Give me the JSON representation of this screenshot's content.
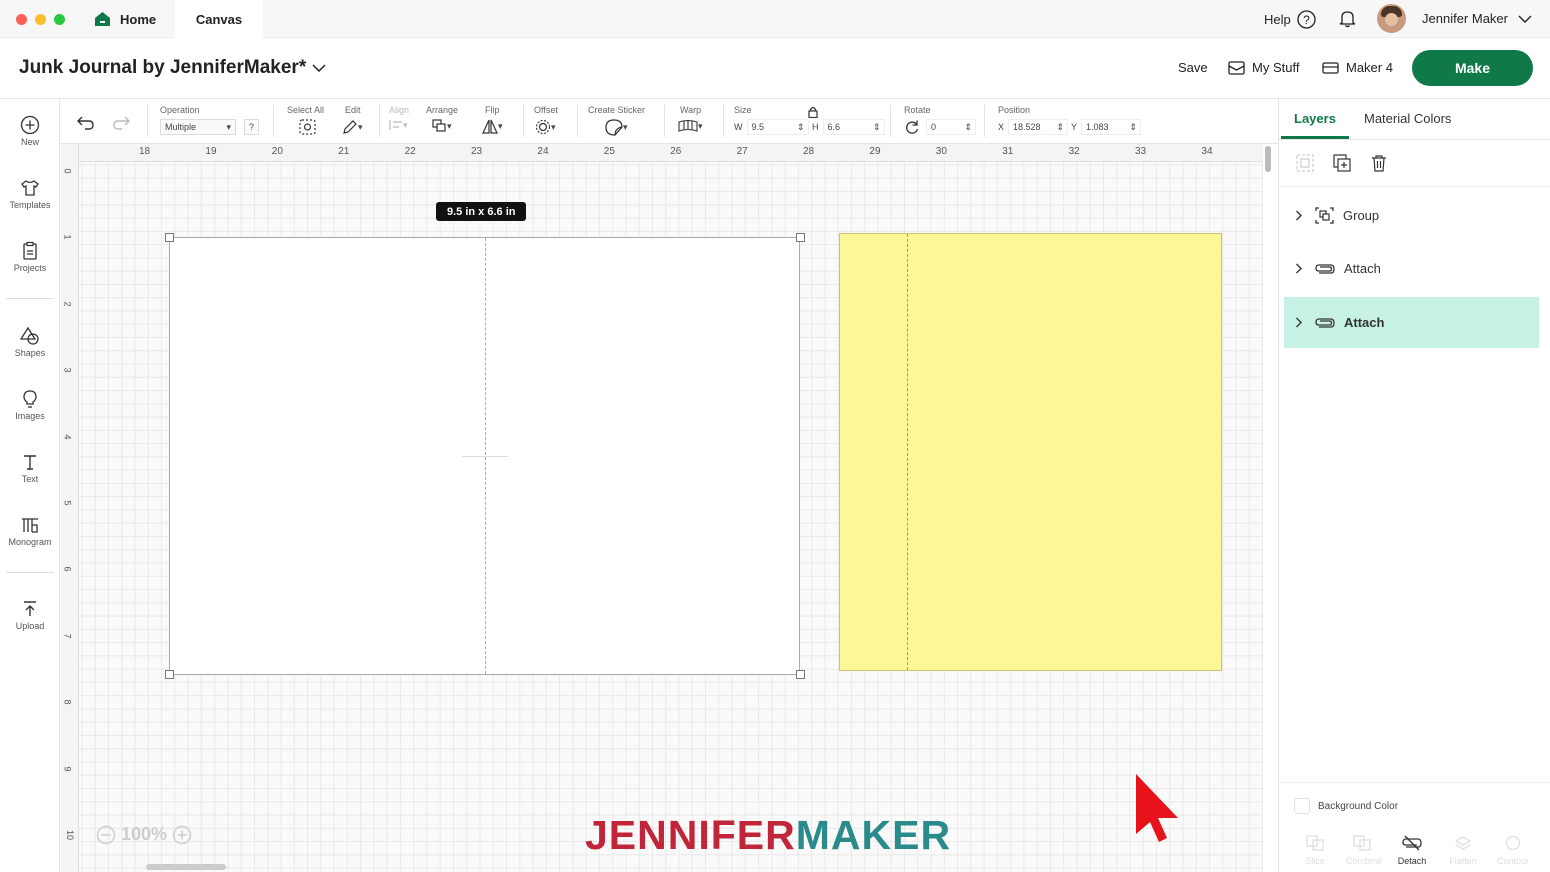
{
  "window": {
    "tabs": [
      {
        "label": "Home"
      },
      {
        "label": "Canvas"
      }
    ],
    "help_label": "Help",
    "user_name": "Jennifer Maker"
  },
  "header": {
    "title": "Junk Journal by JenniferMaker*",
    "save_label": "Save",
    "my_stuff_label": "My Stuff",
    "machine_label": "Maker 4",
    "make_label": "Make"
  },
  "sidebar": {
    "items": [
      {
        "label": "New",
        "icon": "plus-circle-icon"
      },
      {
        "label": "Templates",
        "icon": "shirt-icon"
      },
      {
        "label": "Projects",
        "icon": "clipboard-icon"
      },
      {
        "label": "Shapes",
        "icon": "shapes-icon"
      },
      {
        "label": "Images",
        "icon": "lightbulb-icon"
      },
      {
        "label": "Text",
        "icon": "text-icon"
      },
      {
        "label": "Monogram",
        "icon": "monogram-icon"
      },
      {
        "label": "Upload",
        "icon": "upload-icon"
      }
    ]
  },
  "toolbar": {
    "operation_label": "Operation",
    "operation_value": "Multiple",
    "operation_help": "?",
    "select_all_label": "Select All",
    "edit_label": "Edit",
    "align_label": "Align",
    "arrange_label": "Arrange",
    "flip_label": "Flip",
    "offset_label": "Offset",
    "create_sticker_label": "Create Sticker",
    "warp_label": "Warp",
    "size_label": "Size",
    "w_label": "W",
    "w_value": "9.5",
    "h_label": "H",
    "h_value": "6.6",
    "rotate_label": "Rotate",
    "rotate_value": "0",
    "position_label": "Position",
    "x_label": "X",
    "x_value": "18.528",
    "y_label": "Y",
    "y_value": "1.083"
  },
  "ruler": {
    "top": [
      "18",
      "19",
      "20",
      "21",
      "22",
      "23",
      "24",
      "25",
      "26",
      "27",
      "28",
      "29",
      "30",
      "31",
      "32",
      "33",
      "34"
    ],
    "left": [
      "0",
      "1",
      "2",
      "3",
      "4",
      "5",
      "6",
      "7",
      "8",
      "9",
      "10"
    ]
  },
  "canvas": {
    "selection_size": "9.5  in x 6.6  in",
    "zoom": "100%",
    "card_colors": {
      "white": "#ffffff",
      "yellow": "#fdf796"
    }
  },
  "layers_panel": {
    "tabs": [
      {
        "label": "Layers"
      },
      {
        "label": "Material Colors"
      }
    ],
    "items": [
      {
        "label": "Group",
        "icon": "group-icon",
        "selected": false
      },
      {
        "label": "Attach",
        "icon": "attach-icon",
        "selected": false
      },
      {
        "label": "Attach",
        "icon": "attach-icon",
        "selected": true
      }
    ],
    "background_color_label": "Background Color",
    "bottom_actions": [
      {
        "label": "Slice"
      },
      {
        "label": "Combine"
      },
      {
        "label": "Detach"
      },
      {
        "label": "Flatten"
      },
      {
        "label": "Contour"
      }
    ]
  },
  "brand": {
    "part1": "JENNIFER",
    "part2": "MAKER",
    "color1": "#c0253a",
    "color2": "#2b8a8a"
  },
  "colors": {
    "accent": "#0f7a48",
    "selected_layer": "#c6f1e4"
  }
}
